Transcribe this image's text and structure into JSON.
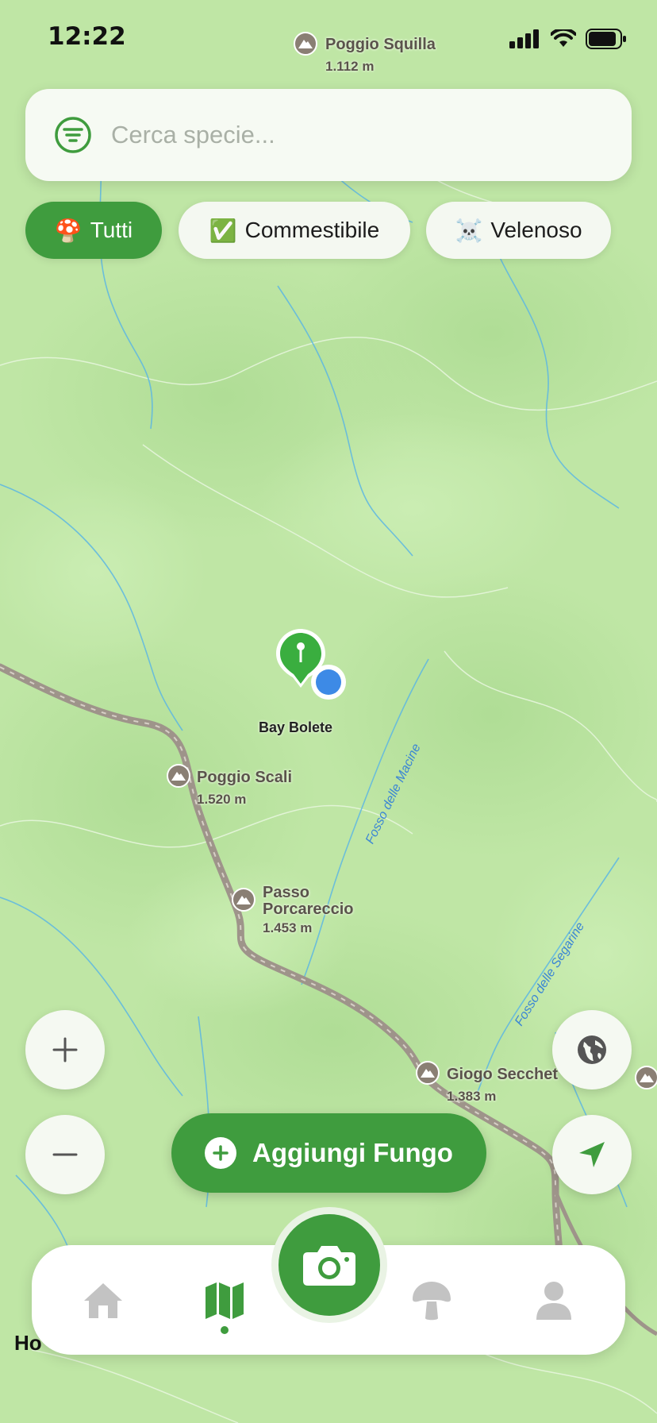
{
  "status_bar": {
    "time": "12:22"
  },
  "search": {
    "placeholder": "Cerca specie..."
  },
  "filters": [
    {
      "emoji": "🍄",
      "label": "Tutti",
      "active": true
    },
    {
      "emoji": "✅",
      "label": "Commestibile",
      "active": false
    },
    {
      "emoji": "☠️",
      "label": "Velenoso",
      "active": false
    }
  ],
  "map": {
    "peaks": [
      {
        "name": "Poggio Squilla",
        "elevation": "1.112 m"
      },
      {
        "name": "Poggio Scali",
        "elevation": "1.520 m"
      },
      {
        "name": "Passo Porcareccio",
        "name_line1": "Passo",
        "name_line2": "Porcareccio",
        "elevation": "1.453 m"
      },
      {
        "name": "Giogo Secchet",
        "elevation": "1.383 m"
      }
    ],
    "streams": [
      "Fosso delle Macine",
      "Fosso delle Segarine"
    ],
    "poi": {
      "label": "Bay Bolete",
      "icon": "map-pin-icon"
    },
    "legal": "Ho"
  },
  "actions": {
    "add_label": "Aggiungi Fungo"
  },
  "tabbar": {
    "items": [
      "home-icon",
      "map-icon",
      "camera-icon",
      "mushroom-icon",
      "profile-icon"
    ],
    "active": "map-icon"
  },
  "colors": {
    "accent": "#3f9c3e",
    "map_bg": "#bfe6a5",
    "stream": "#5cb6e3",
    "road": "#9e948a"
  }
}
